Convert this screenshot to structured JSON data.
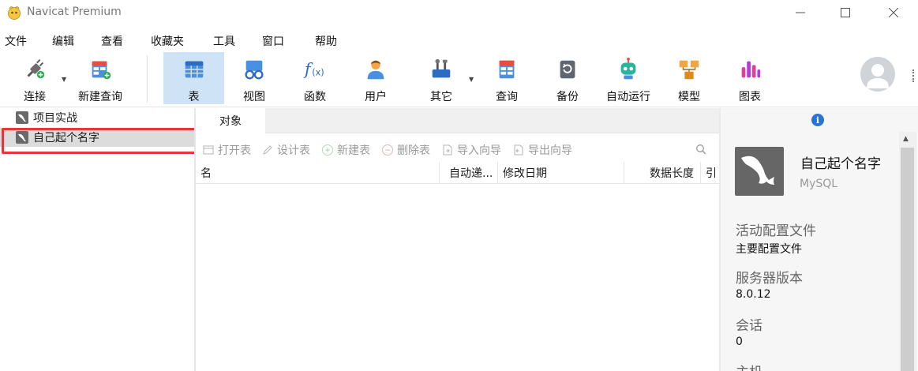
{
  "window": {
    "title": "Navicat Premium",
    "minimize": "—",
    "maximize": "☐",
    "close": "✕"
  },
  "menu": [
    "文件",
    "编辑",
    "查看",
    "收藏夹",
    "工具",
    "窗口",
    "帮助"
  ],
  "toolbar": {
    "connect": "连接",
    "new_query": "新建查询",
    "table": "表",
    "view": "视图",
    "function": "函数",
    "user": "用户",
    "other": "其它",
    "query": "查询",
    "backup": "备份",
    "automation": "自动运行",
    "model": "模型",
    "chart": "图表"
  },
  "tree": {
    "items": [
      {
        "label": "项目实战",
        "selected": false
      },
      {
        "label": "自己起个名字",
        "selected": true
      }
    ]
  },
  "center": {
    "tab": "对象",
    "actions": [
      "打开表",
      "设计表",
      "新建表",
      "删除表",
      "导入向导",
      "导出向导"
    ],
    "columns": [
      "名",
      "自动递...",
      "修改日期",
      "数据长度",
      "引"
    ]
  },
  "info": {
    "icon": "i",
    "name": "自己起个名字",
    "type": "MySQL",
    "fields": [
      {
        "label": "活动配置文件",
        "value": "主要配置文件"
      },
      {
        "label": "服务器版本",
        "value": "8.0.12"
      },
      {
        "label": "会话",
        "value": "0"
      },
      {
        "label": "主机",
        "value": ""
      }
    ]
  },
  "colors": {
    "highlight": "#e8343a",
    "active_tool": "#cfe3f7",
    "selected_row": "#dcdcdc"
  }
}
